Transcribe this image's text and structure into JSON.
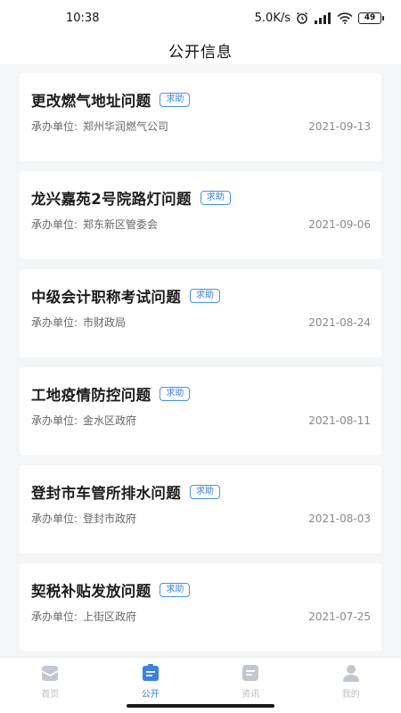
{
  "status_bar": {
    "time": "10:38",
    "network_speed": "5.0K/s",
    "battery": "49",
    "icons": [
      "alarm-icon",
      "signal-icon",
      "wifi-icon",
      "battery-icon"
    ]
  },
  "header": {
    "title": "公开信息"
  },
  "items": [
    {
      "title": "更改燃气地址问题",
      "tag": "求助",
      "org_label": "承办单位:",
      "org": "郑州华润燃气公司",
      "date": "2021-09-13"
    },
    {
      "title": "龙兴嘉苑2号院路灯问题",
      "tag": "求助",
      "org_label": "承办单位:",
      "org": "郑东新区管委会",
      "date": "2021-09-06"
    },
    {
      "title": "中级会计职称考试问题",
      "tag": "求助",
      "org_label": "承办单位:",
      "org": "市财政局",
      "date": "2021-08-24"
    },
    {
      "title": "工地疫情防控问题",
      "tag": "求助",
      "org_label": "承办单位:",
      "org": "金水区政府",
      "date": "2021-08-11"
    },
    {
      "title": "登封市车管所排水问题",
      "tag": "求助",
      "org_label": "承办单位:",
      "org": "登封市政府",
      "date": "2021-08-03"
    },
    {
      "title": "契税补贴发放问题",
      "tag": "求助",
      "org_label": "承办单位:",
      "org": "上街区政府",
      "date": "2021-07-25"
    }
  ],
  "tabs": [
    {
      "label": "首页",
      "icon": "home-icon",
      "active": false
    },
    {
      "label": "公开",
      "icon": "public-icon",
      "active": true
    },
    {
      "label": "资讯",
      "icon": "news-icon",
      "active": false
    },
    {
      "label": "我的",
      "icon": "profile-icon",
      "active": false
    }
  ],
  "colors": {
    "accent": "#3a83dc",
    "inactive": "#b7bcc4",
    "background": "#f4f5f7"
  }
}
